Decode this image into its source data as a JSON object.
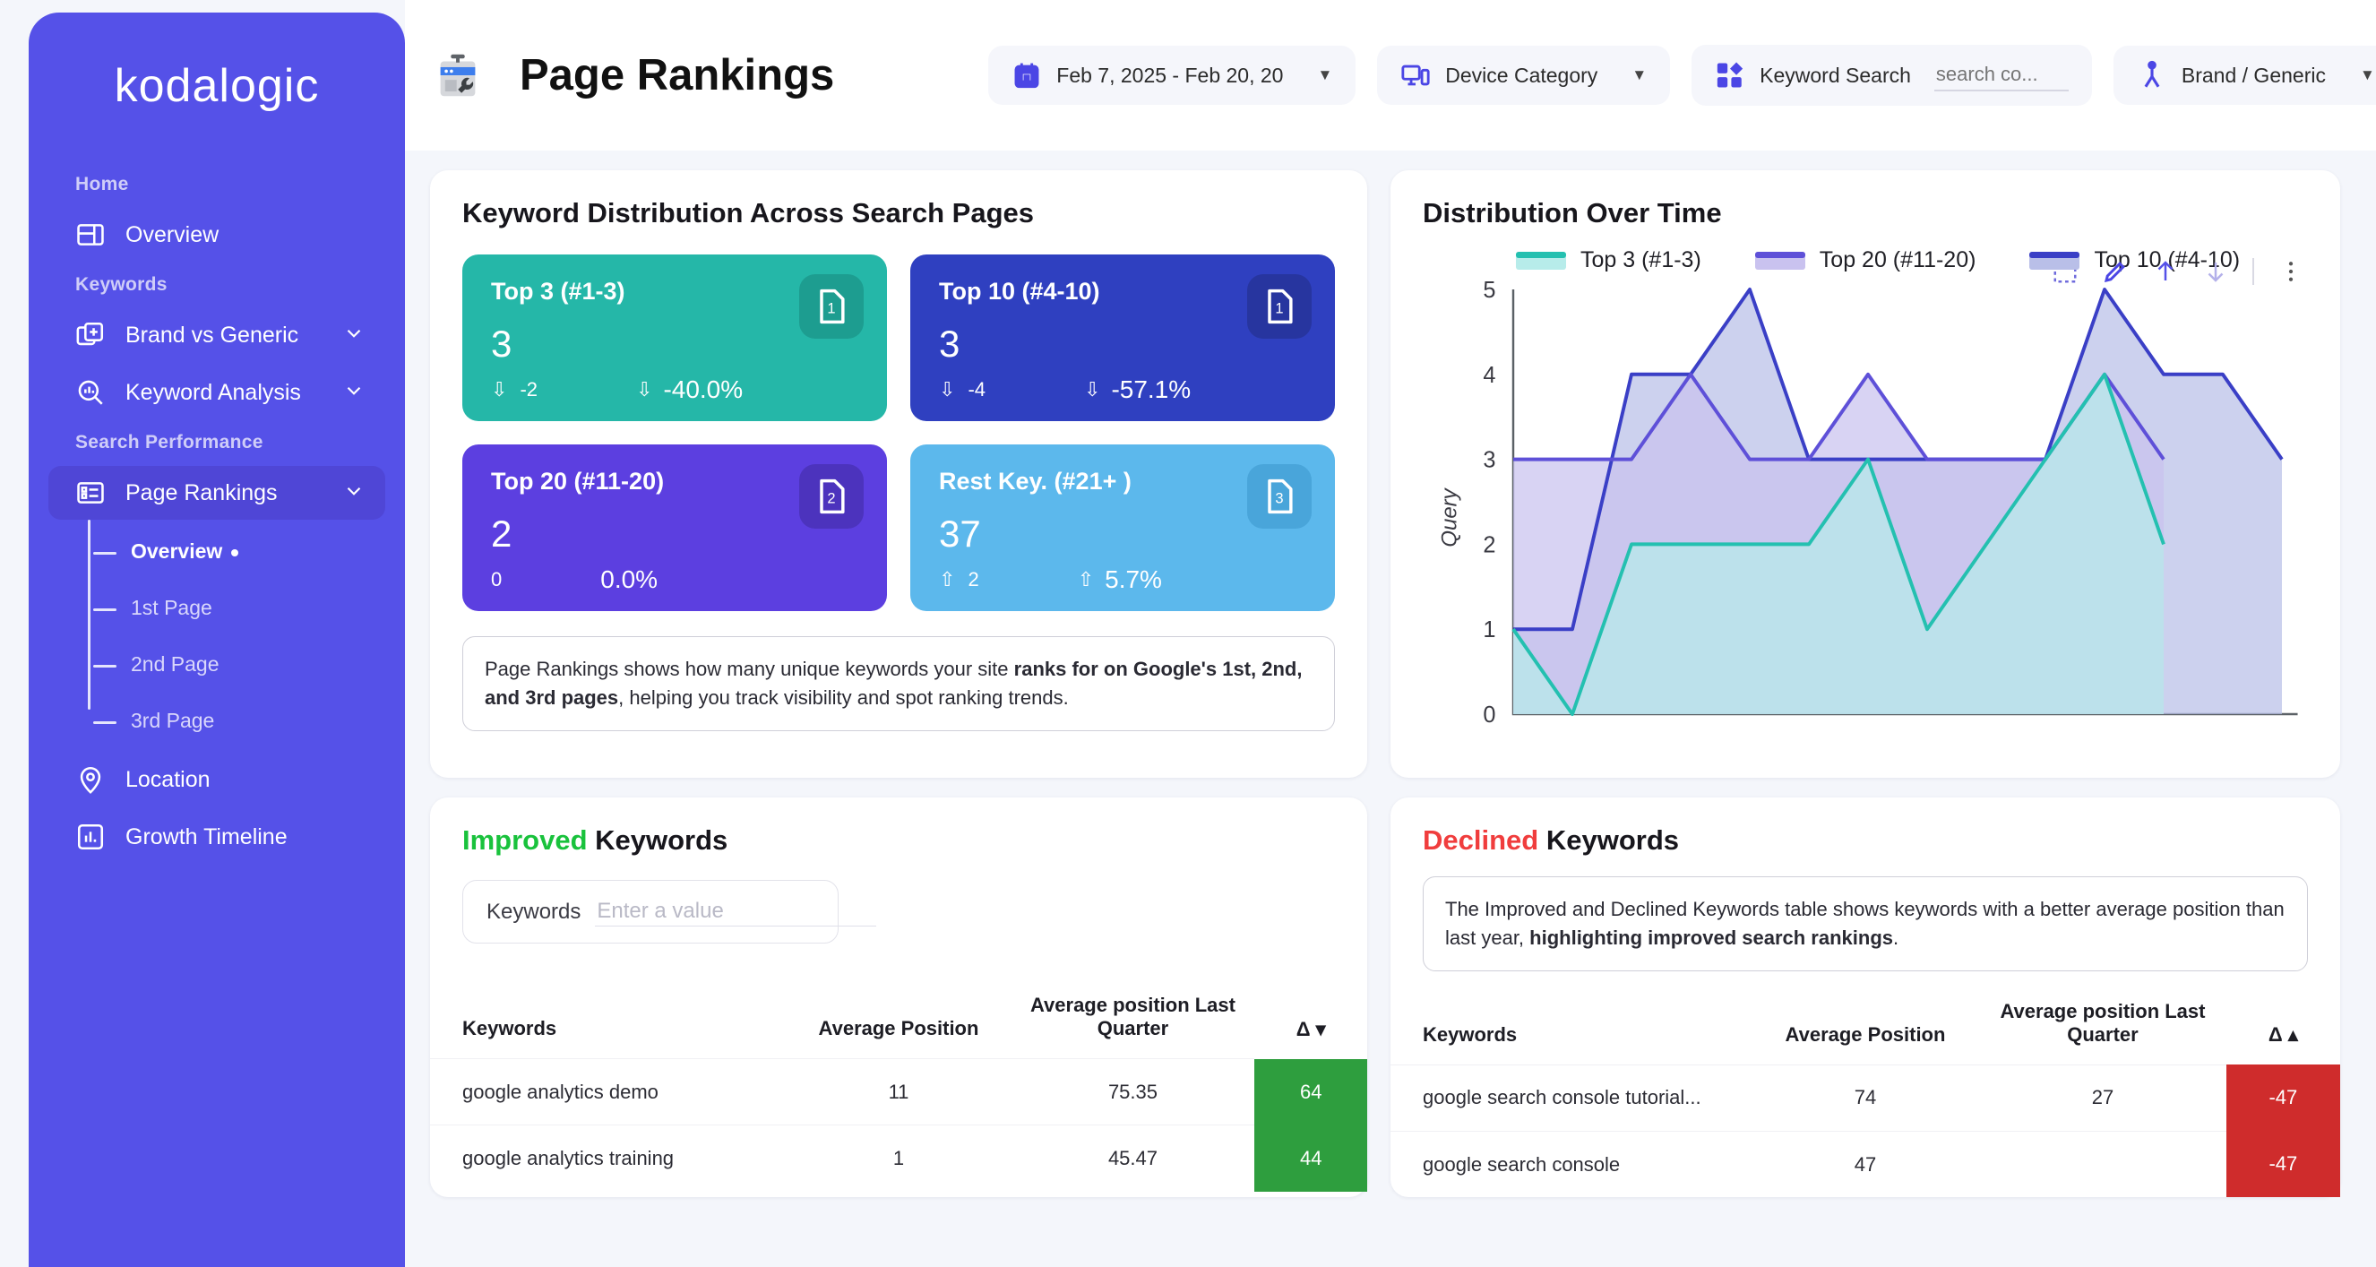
{
  "brand": "kodalogic",
  "sidebar": {
    "sections": [
      {
        "label": "Home",
        "items": [
          {
            "label": "Overview",
            "icon": "dashboard-icon",
            "expandable": false
          }
        ]
      },
      {
        "label": "Keywords",
        "items": [
          {
            "label": "Brand vs Generic",
            "icon": "add-layers-icon",
            "expandable": true
          },
          {
            "label": "Keyword Analysis",
            "icon": "chart-search-icon",
            "expandable": true
          }
        ]
      },
      {
        "label": "Search Performance",
        "items": [
          {
            "label": "Page Rankings",
            "icon": "list-panel-icon",
            "expandable": true,
            "active": true
          }
        ]
      }
    ],
    "sub_items": [
      {
        "label": "Overview",
        "active": true
      },
      {
        "label": "1st Page",
        "active": false
      },
      {
        "label": "2nd Page",
        "active": false
      },
      {
        "label": "3rd Page",
        "active": false
      }
    ],
    "bottom_items": [
      {
        "label": "Location",
        "icon": "map-pin-icon"
      },
      {
        "label": "Growth Timeline",
        "icon": "bar-chart-icon"
      }
    ]
  },
  "header": {
    "title": "Page Rankings",
    "icon": "google-search-console-icon",
    "filters": {
      "date_range": {
        "label": "Feb 7, 2025 - Feb 20, 20",
        "icon": "calendar-icon"
      },
      "device": {
        "label": "Device Category",
        "icon": "device-icon"
      },
      "keyword_search": {
        "label": "Keyword Search",
        "icon": "blocks-icon",
        "placeholder": "search co...",
        "value": ""
      },
      "brand_generic": {
        "label": "Brand / Generic",
        "icon": "person-branch-icon"
      }
    }
  },
  "kpi_card": {
    "title": "Keyword Distribution Across Search Pages",
    "cards": [
      {
        "label": "Top 3 (#1-3)",
        "value": "3",
        "delta": "-2",
        "delta_dir": "down",
        "pct": "-40.0%",
        "pct_dir": "down",
        "badge": "1",
        "bg": "#25b7a8",
        "badge_bg": "#1d9d90"
      },
      {
        "label": "Top 10 (#4-10)",
        "value": "3",
        "delta": "-4",
        "delta_dir": "down",
        "pct": "-57.1%",
        "pct_dir": "down",
        "badge": "1",
        "bg": "#2f40c0",
        "badge_bg": "#27359f"
      },
      {
        "label": "Top 20 (#11-20)",
        "value": "2",
        "delta": "0",
        "delta_dir": "none",
        "pct": "0.0%",
        "pct_dir": "none",
        "badge": "2",
        "bg": "#5c3fe0",
        "badge_bg": "#4c33bd"
      },
      {
        "label": "Rest Key. (#21+ )",
        "value": "37",
        "delta": "2",
        "delta_dir": "up",
        "pct": "5.7%",
        "pct_dir": "up",
        "badge": "3",
        "bg": "#5cb8ec",
        "badge_bg": "#49a5da"
      }
    ],
    "note_prefix": "Page Rankings shows how many unique keywords your site ",
    "note_bold": "ranks for on Google's 1st, 2nd, and 3rd pages",
    "note_suffix": ", helping you track visibility and spot ranking trends."
  },
  "chart_card": {
    "title": "Distribution Over Time",
    "tools": [
      "select-icon",
      "edit-icon",
      "arrow-up-icon",
      "arrow-down-icon",
      "more-vertical-icon"
    ]
  },
  "chart_data": {
    "type": "area",
    "title": "Distribution Over Time",
    "xlabel": "",
    "ylabel": "Query",
    "ylim": [
      0,
      5
    ],
    "yticks": [
      0,
      1,
      2,
      3,
      4,
      5
    ],
    "grid": false,
    "legend_position": "top",
    "x": [
      1,
      2,
      3,
      4,
      5,
      6,
      7,
      8,
      9,
      10,
      11,
      12,
      13,
      14
    ],
    "series": [
      {
        "name": "Top 3 (#1-3)",
        "color": "#24c0b0",
        "fill": "#b7ecea",
        "values": [
          1,
          0,
          2,
          2,
          2,
          2,
          3,
          1,
          2,
          3,
          4,
          2
        ]
      },
      {
        "name": "Top 20 (#11-20)",
        "color": "#5e50d8",
        "fill": "#c9c2ef",
        "values": [
          3,
          3,
          3,
          4,
          3,
          3,
          4,
          3,
          3,
          3,
          4,
          3
        ]
      },
      {
        "name": "Top 10 (#4-10)",
        "color": "#3a3fc6",
        "fill": "#b9bfe8",
        "values": [
          1,
          1,
          4,
          4,
          5,
          3,
          3,
          3,
          3,
          3,
          5,
          4,
          4,
          3
        ]
      }
    ]
  },
  "improved": {
    "title_accent": "Improved",
    "title_rest": " Keywords",
    "filter_label": "Keywords",
    "filter_placeholder": "Enter a value",
    "filter_value": "",
    "columns": [
      "Keywords",
      "Average Position",
      "Average position Last Quarter",
      "Δ"
    ],
    "sort_dir": "desc",
    "rows": [
      {
        "keyword": "google analytics demo",
        "avg_position": "11",
        "avg_last_quarter": "75.35",
        "delta": "64"
      },
      {
        "keyword": "google analytics training",
        "avg_position": "1",
        "avg_last_quarter": "45.47",
        "delta": "44"
      }
    ]
  },
  "declined": {
    "title_accent": "Declined",
    "title_rest": " Keywords",
    "note_prefix": "The Improved and Declined Keywords table shows keywords with a better average position than last year, ",
    "note_bold": "highlighting improved search rankings",
    "note_suffix": ".",
    "columns": [
      "Keywords",
      "Average Position",
      "Average position Last Quarter",
      "Δ"
    ],
    "sort_dir": "asc",
    "rows": [
      {
        "keyword": "google search console tutorial...",
        "avg_position": "74",
        "avg_last_quarter": "27",
        "delta": "-47"
      },
      {
        "keyword": "google search console",
        "avg_position": "47",
        "avg_last_quarter": "",
        "delta": "-47"
      }
    ]
  }
}
